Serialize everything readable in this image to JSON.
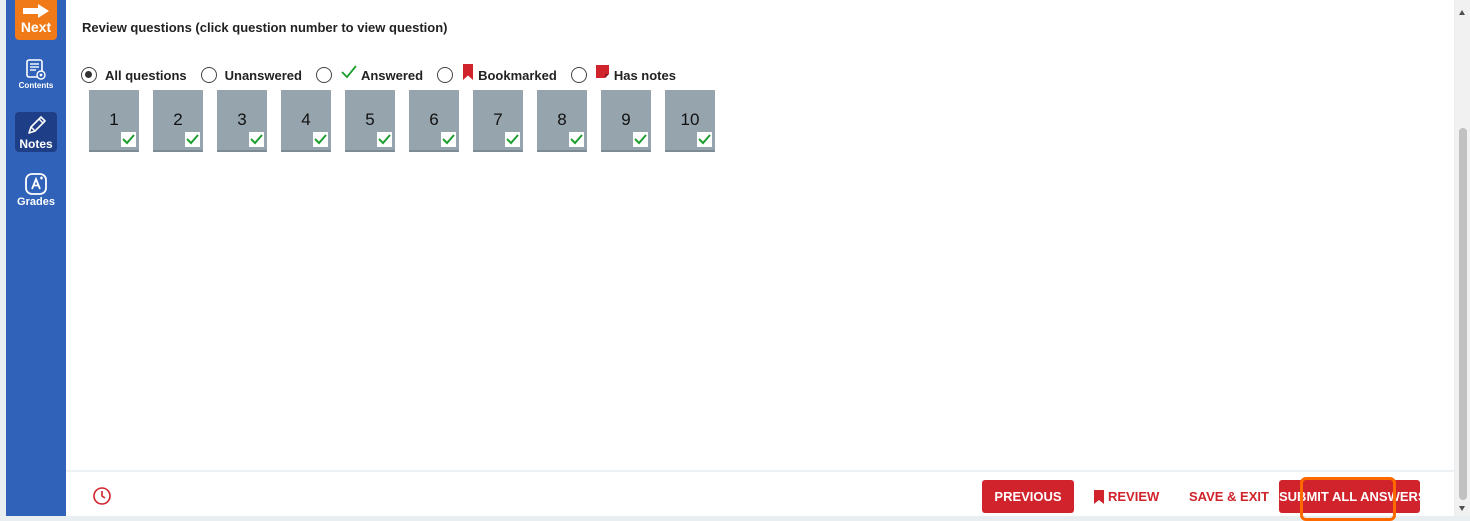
{
  "sidebar": {
    "next_label": "Next",
    "items": [
      {
        "label": "Contents",
        "icon": "contents-icon"
      },
      {
        "label": "Notes",
        "icon": "pencil-icon"
      },
      {
        "label": "Grades",
        "icon": "grades-icon"
      }
    ]
  },
  "review": {
    "title": "Review questions (click question number to view question)",
    "selected_filter": "All questions",
    "filters": [
      {
        "label": "All questions",
        "checked": true
      },
      {
        "label": "Unanswered",
        "checked": false
      },
      {
        "label": "Answered",
        "icon": "checkmark-icon",
        "checked": false
      },
      {
        "label": "Bookmarked",
        "icon": "bookmark-icon",
        "checked": false
      },
      {
        "label": "Has notes",
        "icon": "note-icon",
        "checked": false
      }
    ],
    "questions": [
      {
        "number": "1",
        "answered": true
      },
      {
        "number": "2",
        "answered": true
      },
      {
        "number": "3",
        "answered": true
      },
      {
        "number": "4",
        "answered": true
      },
      {
        "number": "5",
        "answered": true
      },
      {
        "number": "6",
        "answered": true
      },
      {
        "number": "7",
        "answered": true
      },
      {
        "number": "8",
        "answered": true
      },
      {
        "number": "9",
        "answered": true
      },
      {
        "number": "10",
        "answered": true
      }
    ]
  },
  "footer": {
    "timer_icon": "clock-icon",
    "previous_label": "PREVIOUS",
    "review_label": "REVIEW",
    "save_exit_label": "SAVE & EXIT",
    "submit_label": "SUBMIT ALL ANSWERS"
  },
  "colors": {
    "sidebar": "#2f62b8",
    "next": "#f07a17",
    "accent_red": "#d0232c",
    "tile": "#95a4ad",
    "check_green": "#1e9e2e",
    "highlight": "#ff6a00"
  }
}
